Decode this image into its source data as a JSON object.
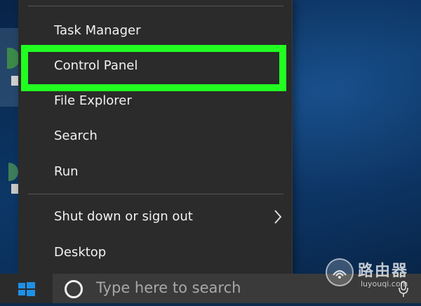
{
  "menu": {
    "items": [
      {
        "label": "Task Manager"
      },
      {
        "label": "Control Panel"
      },
      {
        "label": "File Explorer"
      },
      {
        "label": "Search"
      },
      {
        "label": "Run"
      },
      {
        "label": "Shut down or sign out"
      },
      {
        "label": "Desktop"
      }
    ],
    "highlighted": "Control Panel",
    "highlight_color": "#21ff21"
  },
  "taskbar": {
    "start_icon": "windows-logo-icon",
    "search_icon": "cortana-icon",
    "search_placeholder": "Type here to search",
    "mic_icon": "microphone-icon"
  },
  "watermark": {
    "name": "路由器",
    "url": "luyouqi.com"
  },
  "colors": {
    "menu_bg": "#2b2b2b",
    "windows_blue": "#1e90e6"
  }
}
